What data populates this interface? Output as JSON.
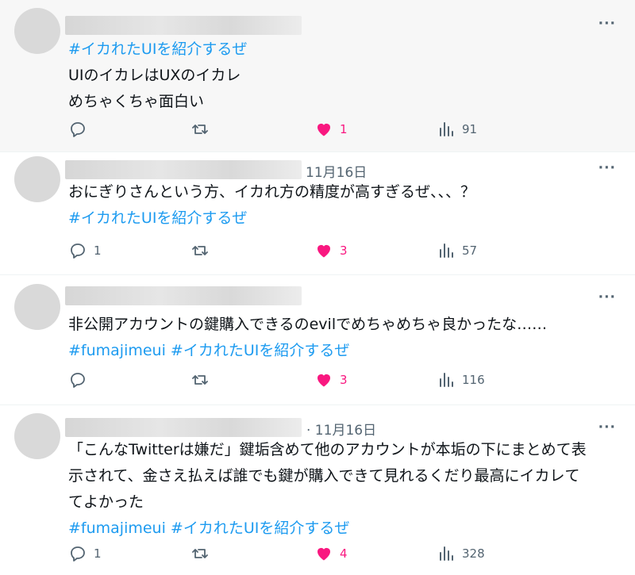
{
  "tweets": [
    {
      "date": "",
      "lines": [
        [
          "#イカれたUIを紹介するぜ"
        ],
        [
          "UIのイカレはUXのイカレ"
        ],
        [
          "めちゃくちゃ面白い"
        ]
      ],
      "reply_count": "",
      "like_count": "1",
      "view_count": "91"
    },
    {
      "date": "11月16日",
      "lines": [
        [
          "おにぎりさんという方、イカれ方の精度が高すぎるぜ、、、？"
        ],
        [
          " #イカれたUIを紹介するぜ"
        ]
      ],
      "reply_count": "1",
      "like_count": "3",
      "view_count": "57"
    },
    {
      "date": "",
      "lines": [
        [
          "非公開アカウントの鍵購入できるのevilでめちゃめちゃ良かったな……"
        ],
        [
          "#fumajimeui #イカれたUIを紹介するぜ"
        ]
      ],
      "reply_count": "",
      "like_count": "3",
      "view_count": "116"
    },
    {
      "date": "· 11月16日",
      "lines": [
        [
          "「こんなTwitterは嫌だ」鍵垢含めて他のアカウントが本垢の下にまとめて表"
        ],
        [
          "示されて、金さえ払えば誰でも鍵が購入できて見れるくだり最高にイカレて"
        ],
        [
          "てよかった"
        ],
        [
          "#fumajimeui #イカれたUIを紹介するぜ"
        ]
      ],
      "reply_count": "1",
      "like_count": "4",
      "view_count": "328"
    }
  ],
  "more_label": "···",
  "colors": {
    "link": "#1d9bf0",
    "like": "#f91880",
    "muted": "#536471"
  }
}
